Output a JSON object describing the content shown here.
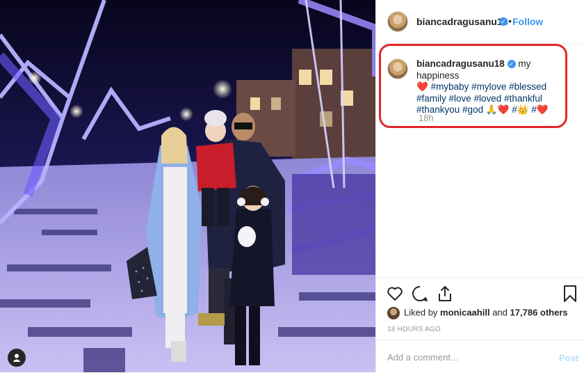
{
  "post": {
    "username": "biancadragusanu18",
    "follow_label": "Follow",
    "dot": "•",
    "verified_glyph": "✓",
    "caption": {
      "username": "biancadragusanu18",
      "text": "my happiness",
      "heart": "❤️",
      "line2_tags": "#mybaby #mylove #blessed",
      "line3_tags": "#family #love #loved #thankful",
      "line4_tags_a": "#thankyou #god",
      "emoji_pray": "🙏",
      "emoji_heart": "❤️",
      "tag_hash": "#",
      "emoji_crown": "👑",
      "tag_hash2": "#",
      "emoji_heart2": "❤️"
    },
    "time_ago": "18h",
    "liked_prefix": "Liked by",
    "liked_user": "monicaahill",
    "liked_and": "and",
    "liked_count": "17,786 others",
    "timestamp": "18 HOURS AGO",
    "comment_placeholder": "Add a comment...",
    "post_label": "Post"
  },
  "icons": [
    "heart-icon",
    "comment-icon",
    "share-icon",
    "bookmark-icon",
    "user-tag-icon",
    "verified-icon"
  ],
  "colors": {
    "accent": "#3897f0",
    "highlight_border": "#e3262b",
    "hashtag": "#003569",
    "muted": "#999999"
  }
}
